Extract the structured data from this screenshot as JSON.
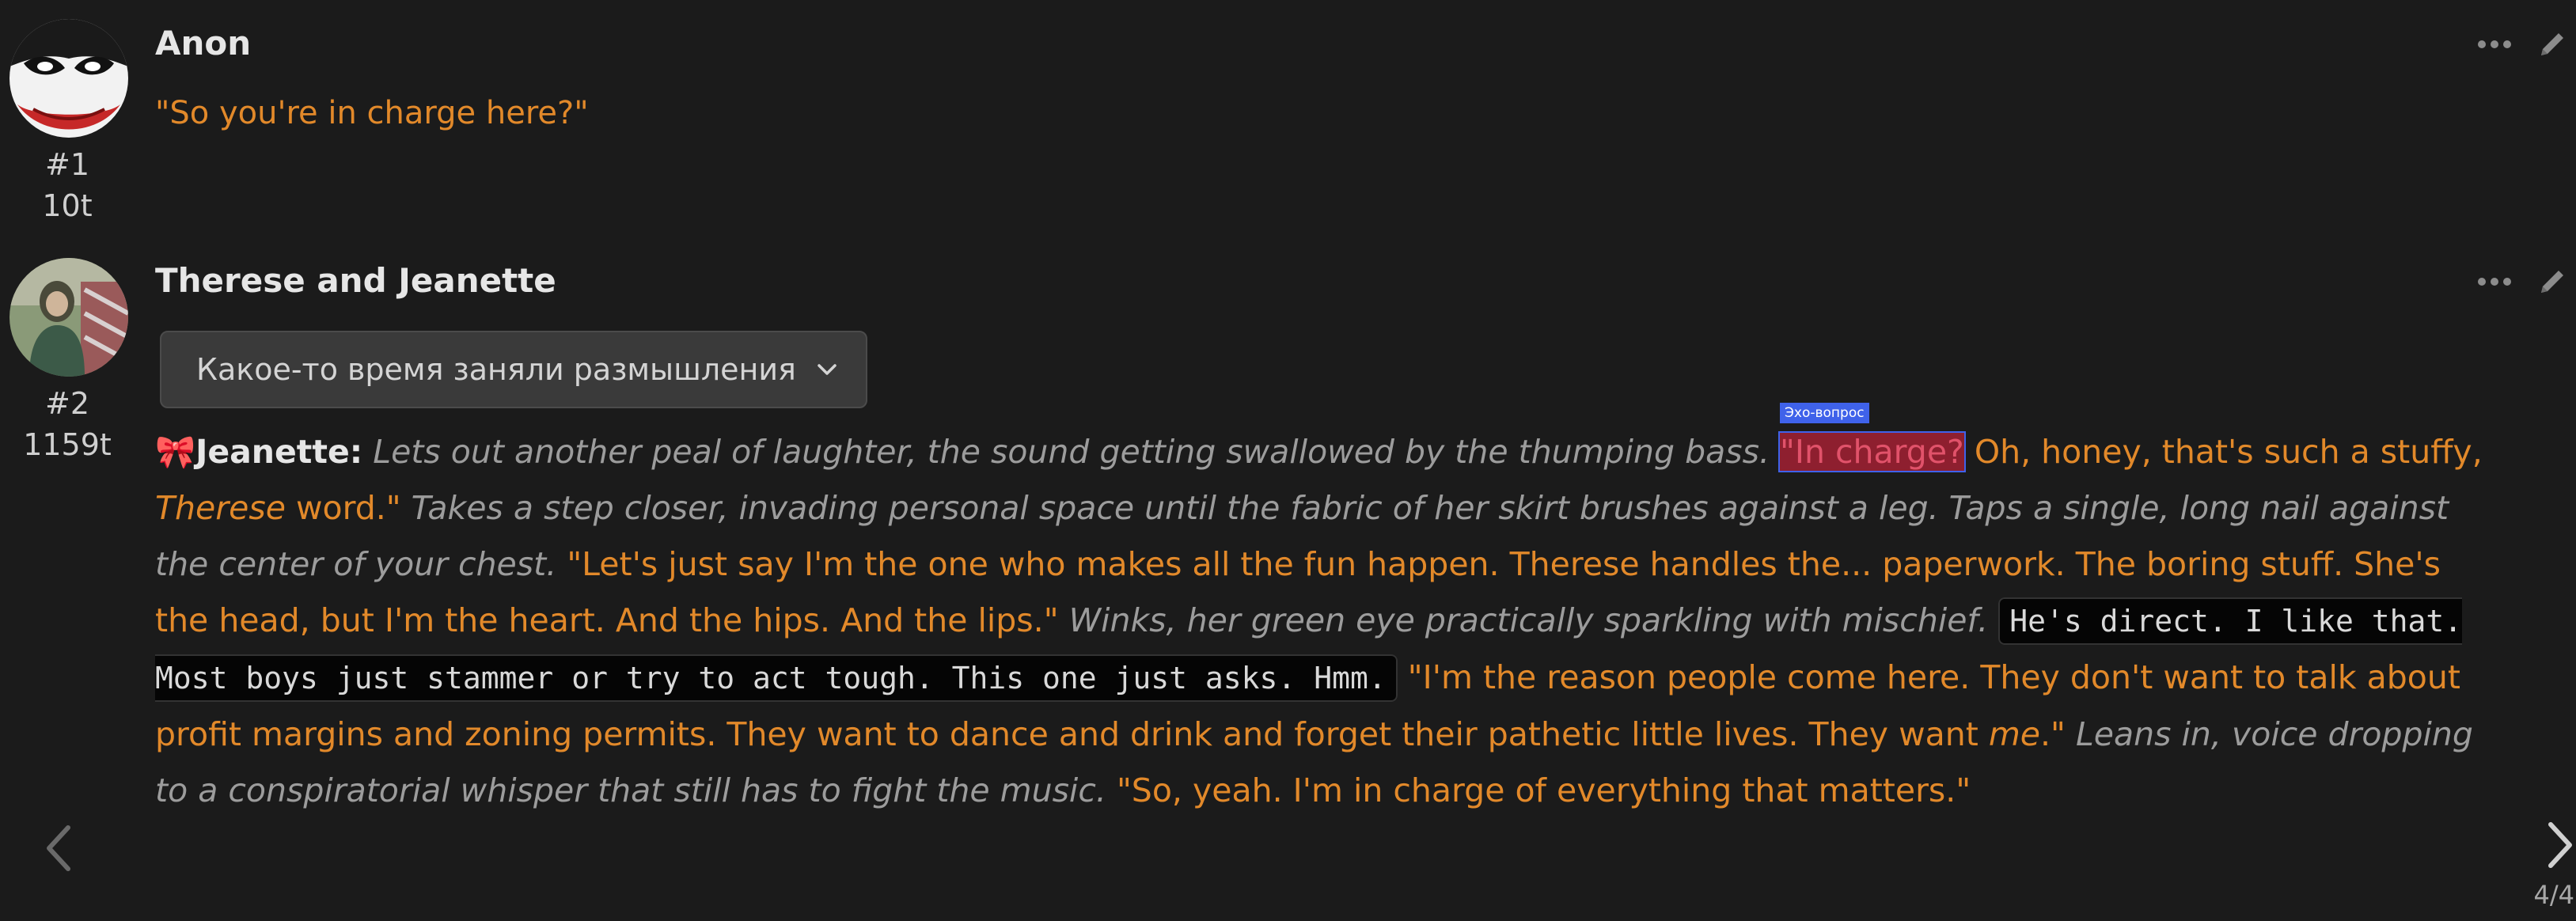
{
  "messages": [
    {
      "name": "Anon",
      "number": "#1",
      "tokens": "10t",
      "avatar": "joker-avatar",
      "text": "\"So you're in charge here?\""
    },
    {
      "name": "Therese and Jeanette",
      "number": "#2",
      "tokens": "1159t",
      "avatar": "character-avatar",
      "reasoning_label": "Какое-то время заняли размышления",
      "speaker": "Jeanette:",
      "highlight_tag": "Эхо-вопрос",
      "segments": {
        "s1": "Lets out another peal of laughter, the sound getting swallowed by the thumping bass.",
        "s2": "\"In charge?",
        "s3": " Oh, honey, that's such a stuffy, ",
        "s4": "Therese",
        "s5": " word.\"",
        "s6": "Takes a step closer, invading personal space until the fabric of her skirt brushes against a leg. Taps a single, long nail against the center of your chest.",
        "s7": "\"Let's just say I'm the one who makes all the fun happen. Therese handles the... paperwork. The boring stuff. She's the head, but I'm the heart. And the hips. And the lips.\"",
        "s8": "Winks, her green eye practically sparkling with mischief.",
        "s9": "He's direct. I like that. Most boys just stammer or try to act tough. This one just asks. Hmm.",
        "s10": "\"I'm the reason people come here. They don't want to talk about profit margins and zoning permits. They want to dance and drink and forget their pathetic little lives. They want ",
        "s11": "me",
        "s12": ".\"",
        "s13": "Leans in, voice dropping to a conspiratorial whisper that still has to fight the music.",
        "s14": "\"So, yeah. I'm in charge of everything that matters.\""
      }
    }
  ],
  "pager": "4/4"
}
